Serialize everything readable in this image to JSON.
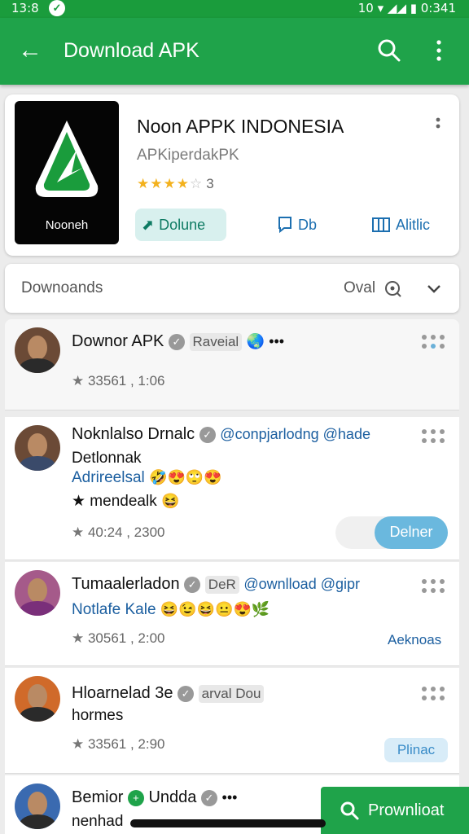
{
  "status_bar": {
    "time": "13:8",
    "right": "10 ▾ ◢◢ ▮ 0:341"
  },
  "header": {
    "title": "Download APK",
    "colors": {
      "primary": "#1fa34a"
    }
  },
  "app": {
    "name": "Noon APPK INDONESIA",
    "subtitle": "APKiperdakPK",
    "rating_count": "3",
    "rating": 3.5,
    "logo_text": "Nooneh",
    "buttons": {
      "install": "Dolune",
      "download": "Db",
      "article": "Alitlic"
    }
  },
  "filter": {
    "label": "Downoands",
    "sort_label": "Oval"
  },
  "items": [
    {
      "name": "Downor APK",
      "tag": "Raveial",
      "emoji": "🌏 •••",
      "meta_icon": "★",
      "meta": "33561 , 1:06"
    },
    {
      "name": "Noknlalso Drnalc",
      "link": "@conpjarlodng @hade",
      "line2": "Detlonnak",
      "line3": "Adrireelsal",
      "line3_emoji": "🤣😍🙄😍",
      "line4": "★ mendealk",
      "line4_emoji": "😆",
      "meta": "40:24 , 2300",
      "button": "Delner"
    },
    {
      "name": "Tumaalerladon",
      "tag": "DeR",
      "link": "@ownlload @gipr",
      "line2": "Notlafe Kale",
      "line2_emoji": "😆😉😆😐😍🌿",
      "meta": "30561 , 2:00",
      "side_link": "Aeknoas"
    },
    {
      "name": "Hloarnelad 3e",
      "tag": "arval Dou",
      "line2": "hormes",
      "meta": "33561 , 2:90",
      "button": "Plinac"
    },
    {
      "name": "Bemior",
      "name2": "Undda",
      "line2": "nenhad",
      "emoji": "•••"
    }
  ],
  "fab": {
    "label": "Prownlioat"
  }
}
